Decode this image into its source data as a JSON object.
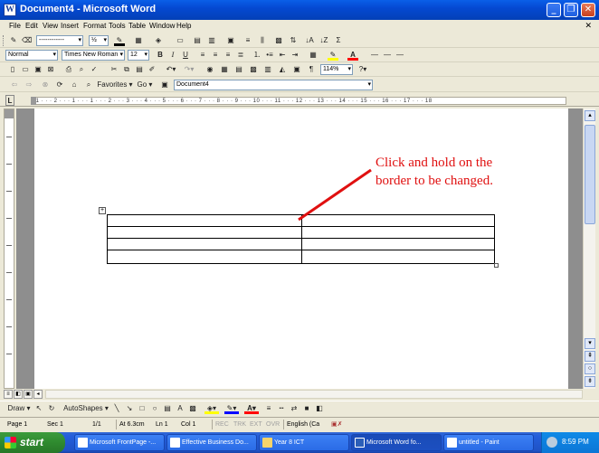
{
  "window": {
    "title": "Document4 - Microsoft Word",
    "minimize": "_",
    "restore": "❐",
    "close": "✕",
    "menu_close": "✕"
  },
  "menu": [
    "File",
    "Edit",
    "View",
    "Insert",
    "Format",
    "Tools",
    "Table",
    "Window",
    "Help"
  ],
  "toolbar_tables": {
    "line_style": "------------",
    "line_weight": "½"
  },
  "formatting": {
    "style": "Normal",
    "font": "Times New Roman",
    "size": "12",
    "bold": "B",
    "italic": "I",
    "underline": "U"
  },
  "standard": {
    "zoom": "114%"
  },
  "web": {
    "favorites": "Favorites ▾",
    "go": "Go ▾",
    "address": "Document4"
  },
  "ruler": {
    "numbers": "· 1 · · · 2 · · · 1 · · · 1 · · · 2 · · · 3 · · · 4 · · · 5 · · · 6 · · · 7 · · · 8 · · · 9 · · · 10 · · · 11 · · · 12 · · · 13 · · · 14 · · · 15 · · · 16 · · · 17 · · · 18"
  },
  "annotation": {
    "line1": "Click and hold on the",
    "line2": "border to be changed."
  },
  "drawing": {
    "draw": "Draw ▾",
    "autoshapes": "AutoShapes ▾"
  },
  "status": {
    "page": "Page 1",
    "sec": "Sec 1",
    "pos": "1/1",
    "at": "At 6.3cm",
    "ln": "Ln 1",
    "col": "Col 1",
    "rec": "REC",
    "trk": "TRK",
    "ext": "EXT",
    "ovr": "OVR",
    "lang": "English (Ca"
  },
  "taskbar": {
    "start": "start",
    "tasks": [
      "Microsoft FrontPage -...",
      "Effective Business Do...",
      "Year 8 ICT",
      "Microsoft Word fo...",
      "untitled - Paint"
    ],
    "clock": "8:59 PM"
  },
  "colors": {
    "annotation": "#e01010",
    "titlebar": "#0549d2"
  }
}
